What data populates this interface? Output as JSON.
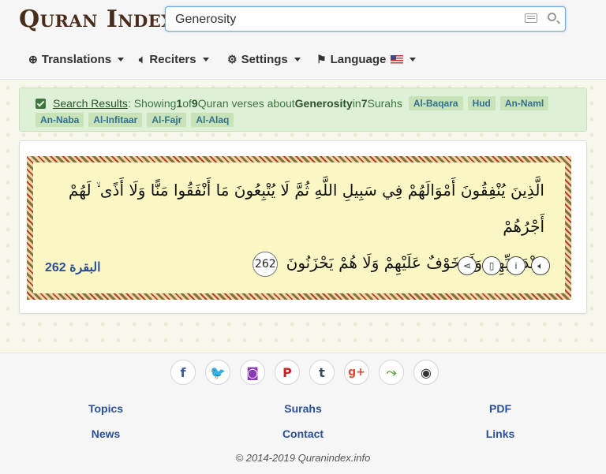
{
  "header": {
    "logo_text": "Quran Index",
    "search": {
      "value": "Generosity"
    },
    "nav": [
      {
        "label": "Translations",
        "icon": "globe-icon"
      },
      {
        "label": "Reciters",
        "icon": "speaker-icon"
      },
      {
        "label": "Settings",
        "icon": "gear-icon"
      },
      {
        "label": "Language",
        "icon": "flag-icon"
      }
    ]
  },
  "results": {
    "link": "Search Results",
    "t1": ": Showing ",
    "shown": "1",
    "t2": " of ",
    "total": "9",
    "t3": " Quran verses about ",
    "topic": "Generosity",
    "t4": " in ",
    "surah_count": "7",
    "t5": " Surahs",
    "surahs": [
      "Al-Baqara",
      "Hud",
      "An-Naml",
      "An-Naba",
      "Al-Infitaar",
      "Al-Fajr",
      "Al-Alaq"
    ]
  },
  "verse": {
    "line1": "الَّذِينَ يُنْفِقُونَ أَمْوَالَهُمْ فِي سَبِيلِ اللَّهِ ثُمَّ لَا يُتْبِعُونَ مَا أَنْفَقُوا مَنًّا وَلَا أَذًى ۙ لَهُمْ أَجْرُهُمْ",
    "line2": "عِنْدَ رَبِّهِمْ وَلَا خَوْفٌ عَلَيْهِمْ وَلَا هُمْ يَحْزَنُونَ",
    "number": "262",
    "surah_name": "البقرة",
    "ref_number": "262"
  },
  "social": [
    {
      "glyph": "f",
      "color": "#3b5998",
      "icon": "facebook-icon"
    },
    {
      "glyph": "🐦",
      "color": "#1da1f2",
      "icon": "twitter-icon"
    },
    {
      "glyph": "◙",
      "color": "#8a3ab9",
      "icon": "instagram-icon"
    },
    {
      "glyph": "P",
      "color": "#cb2027",
      "icon": "pinterest-icon"
    },
    {
      "glyph": "t",
      "color": "#35465c",
      "icon": "tumblr-icon"
    },
    {
      "glyph": "g+",
      "color": "#dd4b39",
      "icon": "google-plus-icon"
    },
    {
      "glyph": "⤳",
      "color": "#5aa040",
      "icon": "share-icon"
    },
    {
      "glyph": "◉",
      "color": "#333333",
      "icon": "github-icon"
    }
  ],
  "footer": {
    "links": [
      "Topics",
      "Surahs",
      "PDF",
      "News",
      "Contact",
      "Links"
    ],
    "copyright": "© 2014-2019 Quranindex.info"
  }
}
